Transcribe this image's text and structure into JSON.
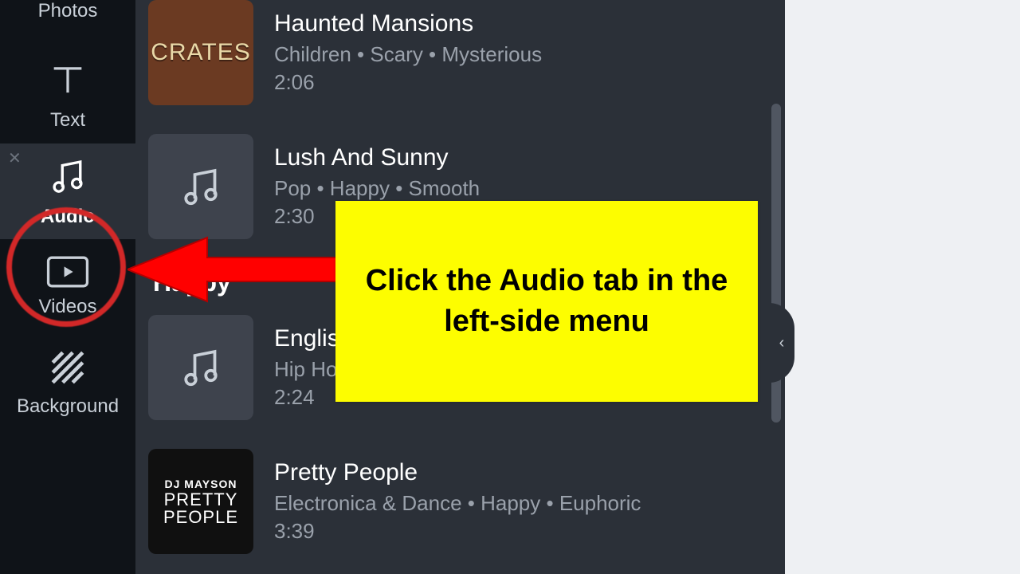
{
  "sidebar": {
    "items": [
      {
        "id": "photos",
        "label": "Photos"
      },
      {
        "id": "text",
        "label": "Text"
      },
      {
        "id": "audio",
        "label": "Audio"
      },
      {
        "id": "videos",
        "label": "Videos"
      },
      {
        "id": "background",
        "label": "Background"
      }
    ],
    "active_id": "audio"
  },
  "panel": {
    "section_title": "Happy",
    "tracks": [
      {
        "title": "Haunted Mansions",
        "meta": "Children • Scary • Mysterious",
        "duration": "2:06",
        "thumb": "crates",
        "thumb_text": "CRATES"
      },
      {
        "title": "Lush And Sunny",
        "meta": "Pop • Happy • Smooth",
        "duration": "2:30",
        "thumb": "music"
      },
      {
        "title": "English",
        "meta": "Hip Hop",
        "duration": "2:24",
        "thumb": "music"
      },
      {
        "title": "Pretty People",
        "meta": "Electronica & Dance • Happy • Euphoric",
        "duration": "3:39",
        "thumb": "pretty",
        "thumb_l1": "DJ MAYSON",
        "thumb_l2": "PRETTY",
        "thumb_l3": "PEOPLE"
      }
    ]
  },
  "annotation": {
    "callout": "Click the Audio tab in the left-side menu"
  },
  "collapse_glyph": "‹"
}
